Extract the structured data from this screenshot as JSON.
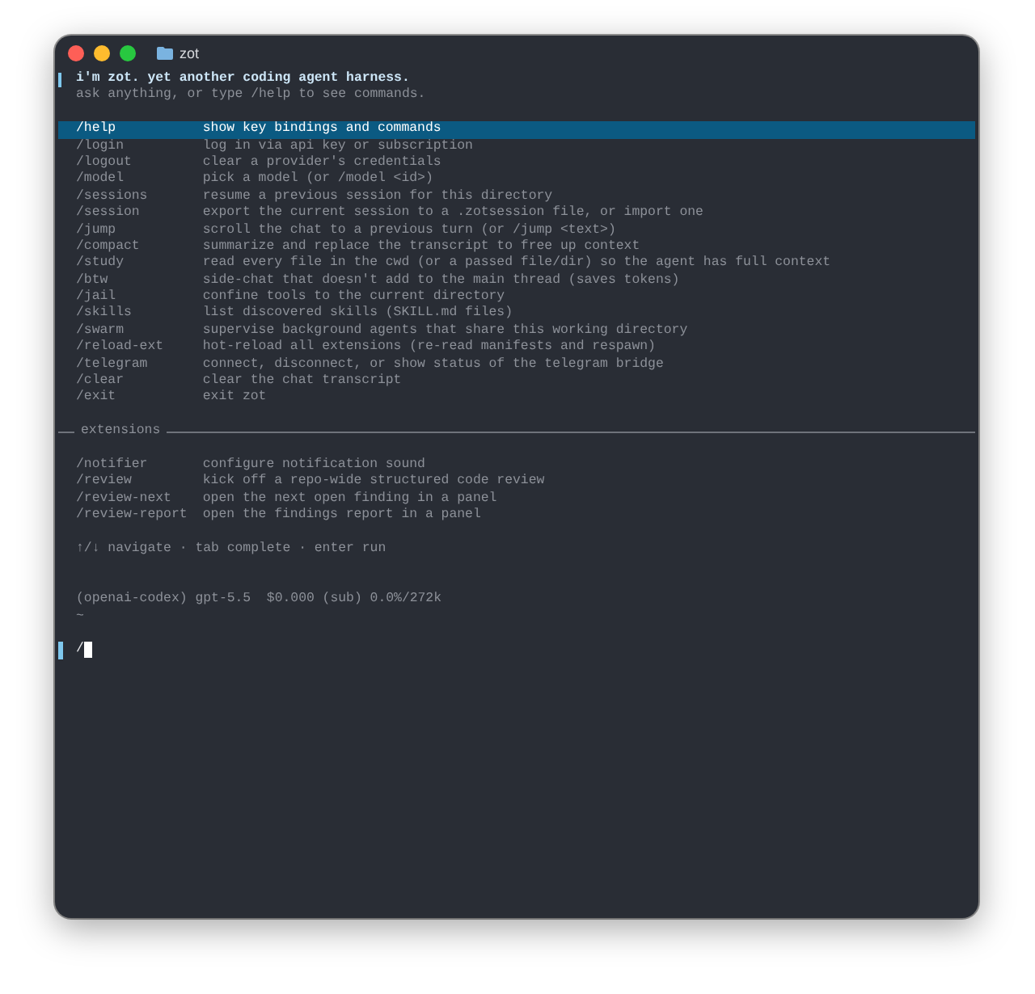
{
  "window": {
    "title": "zot"
  },
  "intro": {
    "title": "i'm zot. yet another coding agent harness.",
    "hint": "ask anything, or type /help to see commands."
  },
  "commands": [
    {
      "name": "/help",
      "description": "show key bindings and commands",
      "selected": true
    },
    {
      "name": "/login",
      "description": "log in via api key or subscription",
      "selected": false
    },
    {
      "name": "/logout",
      "description": "clear a provider's credentials",
      "selected": false
    },
    {
      "name": "/model",
      "description": "pick a model (or /model <id>)",
      "selected": false
    },
    {
      "name": "/sessions",
      "description": "resume a previous session for this directory",
      "selected": false
    },
    {
      "name": "/session",
      "description": "export the current session to a .zotsession file, or import one",
      "selected": false
    },
    {
      "name": "/jump",
      "description": "scroll the chat to a previous turn (or /jump <text>)",
      "selected": false
    },
    {
      "name": "/compact",
      "description": "summarize and replace the transcript to free up context",
      "selected": false
    },
    {
      "name": "/study",
      "description": "read every file in the cwd (or a passed file/dir) so the agent has full context",
      "selected": false
    },
    {
      "name": "/btw",
      "description": "side-chat that doesn't add to the main thread (saves tokens)",
      "selected": false
    },
    {
      "name": "/jail",
      "description": "confine tools to the current directory",
      "selected": false
    },
    {
      "name": "/skills",
      "description": "list discovered skills (SKILL.md files)",
      "selected": false
    },
    {
      "name": "/swarm",
      "description": "supervise background agents that share this working directory",
      "selected": false
    },
    {
      "name": "/reload-ext",
      "description": "hot-reload all extensions (re-read manifests and respawn)",
      "selected": false
    },
    {
      "name": "/telegram",
      "description": "connect, disconnect, or show status of the telegram bridge",
      "selected": false
    },
    {
      "name": "/clear",
      "description": "clear the chat transcript",
      "selected": false
    },
    {
      "name": "/exit",
      "description": "exit zot",
      "selected": false
    }
  ],
  "extensions": {
    "title": "extensions",
    "commands": [
      {
        "name": "/notifier",
        "description": "configure notification sound",
        "selected": false
      },
      {
        "name": "/review",
        "description": "kick off a repo-wide structured code review",
        "selected": false
      },
      {
        "name": "/review-next",
        "description": "open the next open finding in a panel",
        "selected": false
      },
      {
        "name": "/review-report",
        "description": "open the findings report in a panel",
        "selected": false
      }
    ]
  },
  "key_hint": "↑/↓ navigate · tab complete · enter run",
  "status": {
    "model": "(openai-codex) gpt-5.5  $0.000 (sub) 0.0%/272k",
    "cwd": "~"
  },
  "prompt": {
    "value": "/"
  }
}
